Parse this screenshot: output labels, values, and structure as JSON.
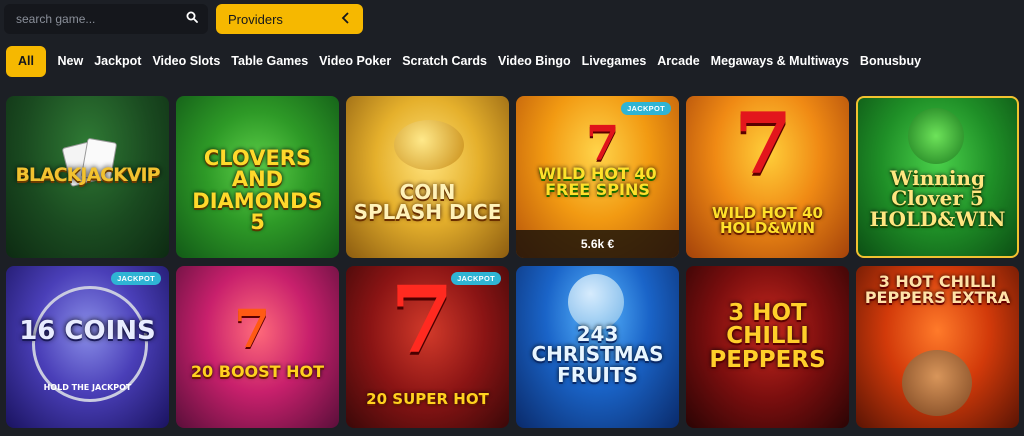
{
  "search": {
    "placeholder": "search game..."
  },
  "providers": {
    "label": "Providers"
  },
  "tabs": [
    "All",
    "New",
    "Jackpot",
    "Video Slots",
    "Table Games",
    "Video Poker",
    "Scratch Cards",
    "Video Bingo",
    "Livegames",
    "Arcade",
    "Megaways & Multiways",
    "Bonusbuy"
  ],
  "games": [
    {
      "title": "BLACKJACKVIP"
    },
    {
      "title": "CLOVERS AND DIAMONDS 5"
    },
    {
      "title": "COIN SPLASH DICE"
    },
    {
      "title": "WILD HOT 40 FREE SPINS",
      "badge": "JACKPOT",
      "jackpot": "5.6k €"
    },
    {
      "title": "WILD HOT 40 HOLD&WIN"
    },
    {
      "title": "Winning Clover 5 HOLD&WIN"
    },
    {
      "title": "16 COINS",
      "subtitle": "HOLD THE JACKPOT",
      "badge": "JACKPOT"
    },
    {
      "title": "20 BOOST HOT"
    },
    {
      "title": "20 SUPER HOT",
      "badge": "JACKPOT"
    },
    {
      "title": "243 CHRISTMAS FRUITS"
    },
    {
      "title": "3 HOT CHILLI PEPPERS"
    },
    {
      "title": "3 HOT CHILLI PEPPERS EXTRA"
    }
  ],
  "colors": {
    "accent": "#f6b800",
    "badge": "#2fb4d4",
    "background": "#1c1f25"
  }
}
